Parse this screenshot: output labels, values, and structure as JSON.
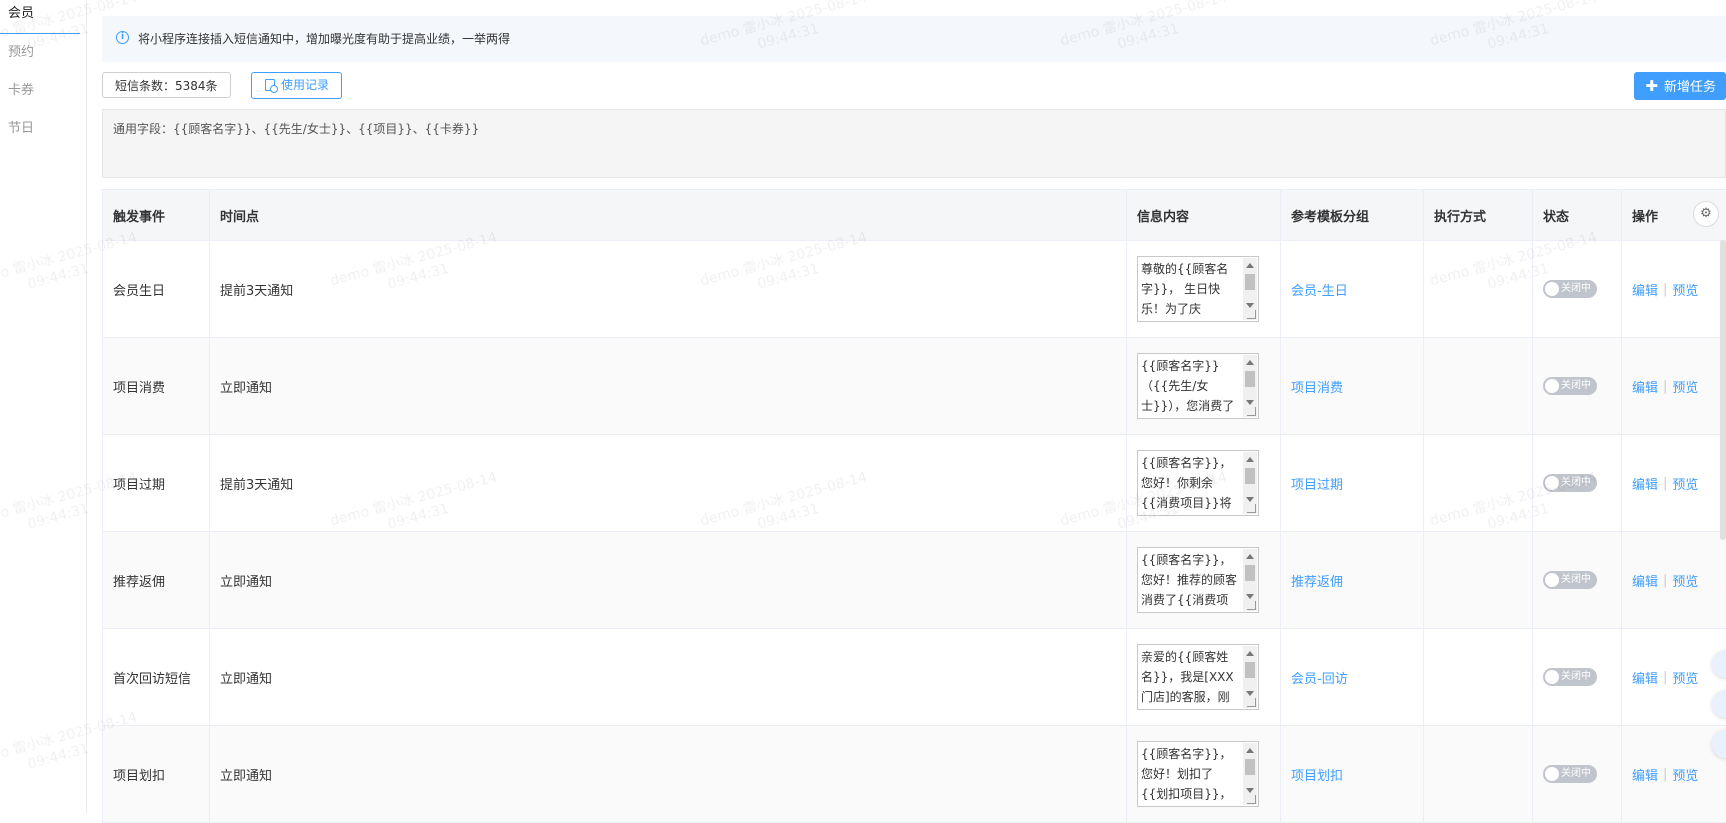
{
  "sidenav": {
    "items": [
      {
        "label": "会员",
        "active": true
      },
      {
        "label": "预约",
        "active": false
      },
      {
        "label": "卡券",
        "active": false
      },
      {
        "label": "节日",
        "active": false
      }
    ]
  },
  "info_bar": {
    "icon": "info-icon",
    "text": "将小程序连接插入短信通知中，增加曝光度有助于提高业绩，一举两得"
  },
  "toolbar": {
    "sms_count_label": "短信条数：5384条",
    "usage_label": "使用记录",
    "add_label": "新增任务"
  },
  "fields_box": {
    "text": "通用字段：{{顾客名字}}、{{先生/女士}}、{{项目}}、{{卡券}}"
  },
  "table": {
    "headers": [
      "触发事件",
      "时间点",
      "信息内容",
      "参考模板分组",
      "执行方式",
      "状态",
      "操作"
    ],
    "rows": [
      {
        "event": "会员生日",
        "time": "提前3天通知",
        "message": "尊敬的{{顾客名字}}，\n生日快乐！为了庆",
        "group": "会员-生日",
        "method": "",
        "status": "关闭中",
        "edit": "编辑",
        "preview": "预览"
      },
      {
        "event": "项目消费",
        "time": "立即通知",
        "message": "{{顾客名字}}（{{先生/女士}}），您消费了{{消费项",
        "group": "项目消费",
        "method": "",
        "status": "关闭中",
        "edit": "编辑",
        "preview": "预览"
      },
      {
        "event": "项目过期",
        "time": "提前3天通知",
        "message": " {{顾客名字}}，您好！你剩余{{消费项目}}将在{{有效",
        "group": "项目过期",
        "method": "",
        "status": "关闭中",
        "edit": "编辑",
        "preview": "预览"
      },
      {
        "event": "推荐返佣",
        "time": "立即通知",
        "message": " {{顾客名字}}，您好！推荐的顾客消费了{{消费项",
        "group": "推荐返佣",
        "method": "",
        "status": "关闭中",
        "edit": "编辑",
        "preview": "预览"
      },
      {
        "event": "首次回访短信",
        "time": "立即通知",
        "message": "亲爱的{{顾客姓名}}，我是[XXX门店]的客服，刚才",
        "group": "会员-回访",
        "method": "",
        "status": "关闭中",
        "edit": "编辑",
        "preview": "预览"
      },
      {
        "event": "项目划扣",
        "time": "立即通知",
        "message": "{{顾客名字}}，您好！划扣了{{划扣项目}}，{{划扣金额}}",
        "group": "项目划扣",
        "method": "",
        "status": "关闭中",
        "edit": "编辑",
        "preview": "预览"
      }
    ]
  },
  "watermark": {
    "line1": "demo 雷小冰 2025-08-14",
    "line2": "09:44:31"
  },
  "colors": {
    "accent": "#409eff",
    "info_bg": "#f4f7fc",
    "toggle_off": "#c0c4cc"
  }
}
